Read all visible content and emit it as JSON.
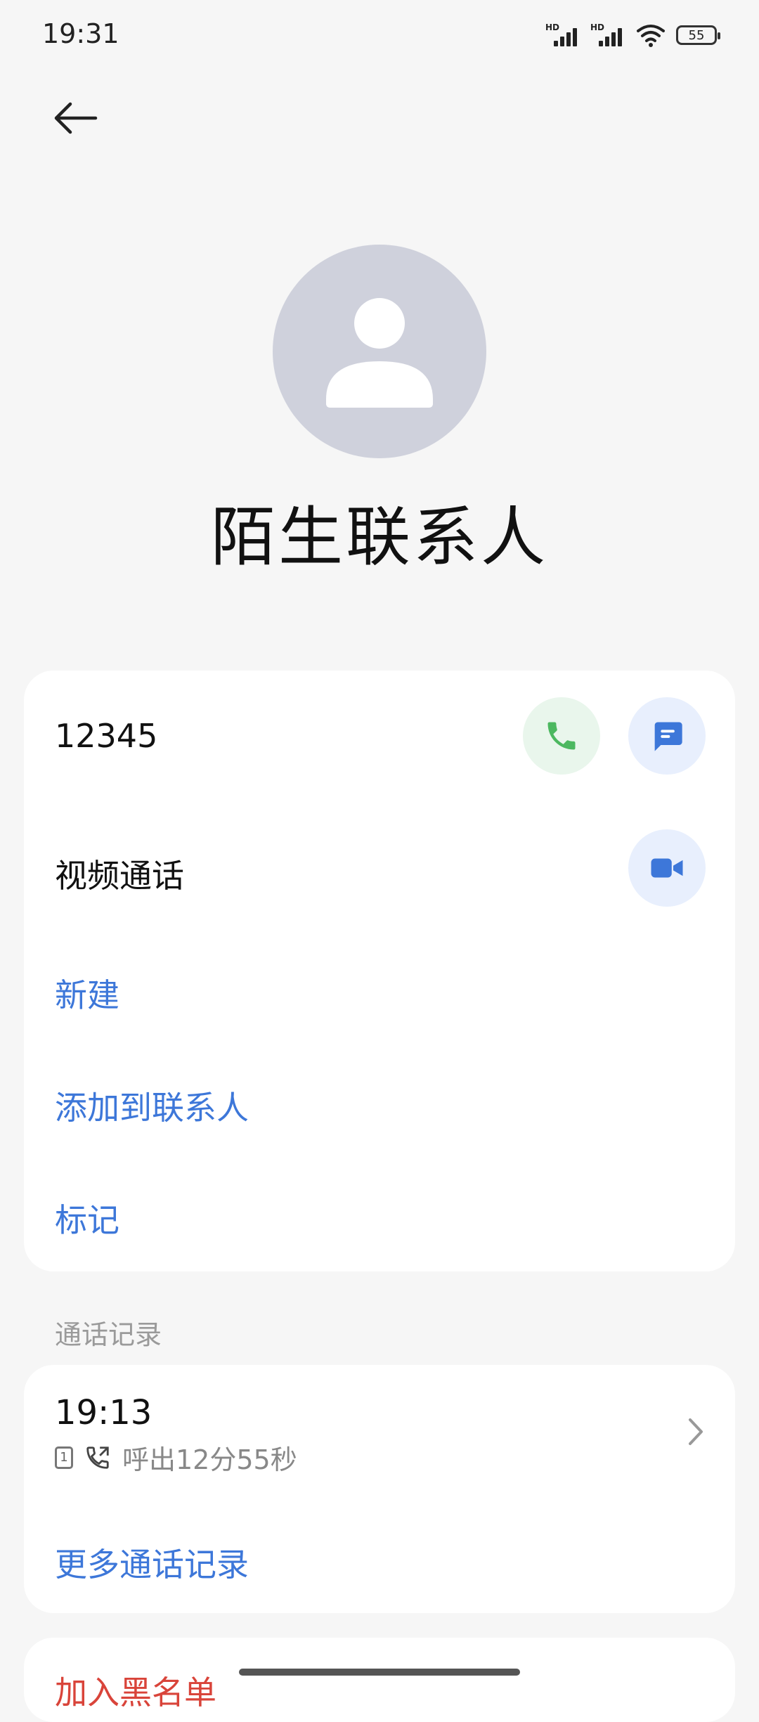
{
  "status_bar": {
    "time": "19:31",
    "sim1_label": "HD",
    "sim2_label": "HD",
    "battery": "55",
    "icons": [
      "signal-icon",
      "signal-icon",
      "wifi-icon",
      "battery-icon"
    ]
  },
  "header": {
    "back_icon": "arrow-left-icon"
  },
  "contact": {
    "avatar_icon": "person-icon",
    "name": "陌生联系人"
  },
  "details": {
    "phone_number": "12345",
    "call_icon": "phone-icon",
    "message_icon": "message-icon",
    "video_call_label": "视频通话",
    "video_icon": "video-camera-icon",
    "new_label": "新建",
    "add_to_contacts_label": "添加到联系人",
    "mark_label": "标记"
  },
  "call_log": {
    "section_title": "通话记录",
    "entries": [
      {
        "time": "19:13",
        "sim": "1",
        "type_icon": "outgoing-call-icon",
        "description": "呼出12分55秒"
      }
    ],
    "more_label": "更多通话记录"
  },
  "blacklist": {
    "label": "加入黑名单"
  },
  "colors": {
    "accent_blue": "#3d77d9",
    "call_green": "#4cb860",
    "danger_red": "#d9443a",
    "background": "#f6f6f6"
  }
}
